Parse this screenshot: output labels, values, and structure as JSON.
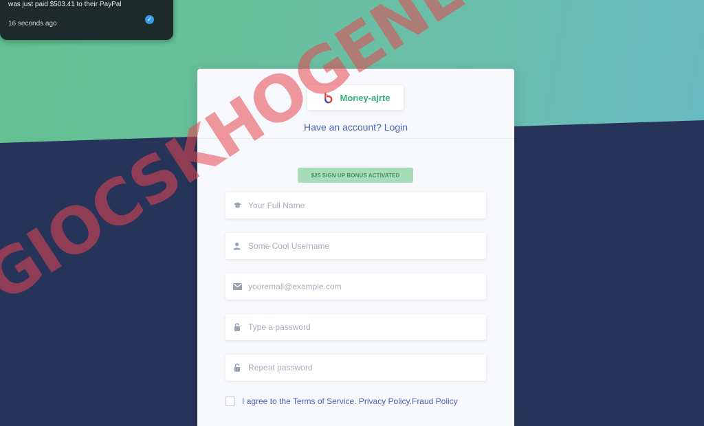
{
  "toast": {
    "message": "was just paid $503.41 to their PayPal",
    "time": "16 seconds ago",
    "verified_icon": "check-circle-icon"
  },
  "card": {
    "brand_name": "Money-ajrte",
    "login_prompt": "Have an account? Login",
    "bonus_badge": "$25 SIGN UP BONUS ACTIVATED",
    "fields": {
      "full_name": {
        "placeholder": "Your Full Name",
        "icon": "graduation-cap-icon"
      },
      "username": {
        "placeholder": "Some Cool Username",
        "icon": "user-icon"
      },
      "email": {
        "placeholder": "youremail@example.com",
        "icon": "envelope-icon"
      },
      "password": {
        "placeholder": "Type a password",
        "icon": "lock-icon"
      },
      "repeat_password": {
        "placeholder": "Repeat password",
        "icon": "lock-icon"
      }
    },
    "agree_text": "I agree to the Terms of Service. Privacy Policy.Fraud Policy"
  },
  "watermark": "GIOCSKHOGENERAL.BLOGSPOT.COM",
  "colors": {
    "brand_green": "#3bb07d",
    "link_blue": "#4b63b8",
    "navy_bg": "#27345a",
    "watermark_red": "#e64650"
  }
}
